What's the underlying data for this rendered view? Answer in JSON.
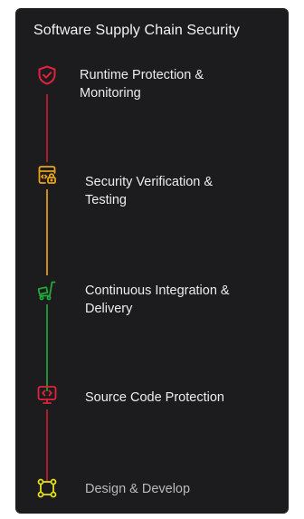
{
  "title": "Software Supply Chain Security",
  "steps": [
    {
      "label_line1": "Runtime Protection &",
      "label_line2": "Monitoring",
      "icon": "shield-check-icon",
      "color": "#e0233a"
    },
    {
      "label_line1": "Security Verification &",
      "label_line2": "Testing",
      "icon": "code-lock-icon",
      "color": "#e8a21a"
    },
    {
      "label_line1": "Continuous Integration &",
      "label_line2": "Delivery",
      "icon": "delivery-cart-icon",
      "color": "#22a83a"
    },
    {
      "label_line1": "Source Code Protection",
      "icon": "monitor-code-icon",
      "color": "#e0233a"
    },
    {
      "label_line1": "Design & Develop",
      "icon": "nodes-icon",
      "color": "#e6e01a"
    }
  ],
  "connector_colors": [
    "#a91d2c",
    "#c78c1c",
    "#1d8f35",
    "#a91d2c"
  ]
}
